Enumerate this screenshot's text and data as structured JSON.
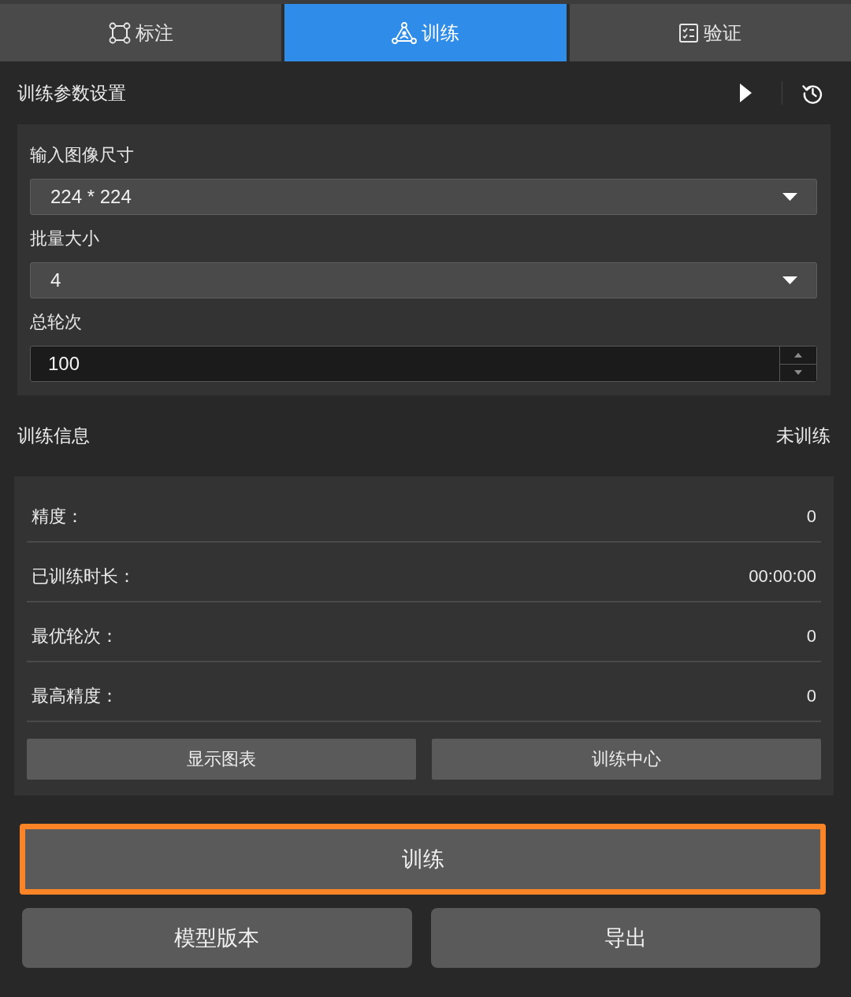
{
  "tabs": [
    {
      "label": "标注",
      "kind": "box",
      "selected": false
    },
    {
      "label": "训练",
      "kind": "network",
      "selected": true
    },
    {
      "label": "验证",
      "kind": "checklist",
      "selected": false
    }
  ],
  "params": {
    "title": "训练参数设置",
    "fields": [
      {
        "label": "输入图像尺寸",
        "kind": "dropdown",
        "value": "224 * 224"
      },
      {
        "label": "批量大小",
        "kind": "dropdown",
        "value": "4"
      },
      {
        "label": "总轮次",
        "kind": "spinbox",
        "value": "100"
      }
    ]
  },
  "info": {
    "title": "训练信息",
    "status": "未训练",
    "rows": [
      {
        "label": "精度：",
        "value": "0"
      },
      {
        "label": "已训练时长：",
        "value": "00:00:00"
      },
      {
        "label": "最优轮次：",
        "value": "0"
      },
      {
        "label": "最高精度：",
        "value": "0"
      }
    ],
    "buttons": [
      "显示图表",
      "训练中心"
    ]
  },
  "actions": {
    "train": {
      "label": "训练",
      "highlighted": true
    },
    "buttons": [
      "模型版本",
      "导出"
    ]
  }
}
